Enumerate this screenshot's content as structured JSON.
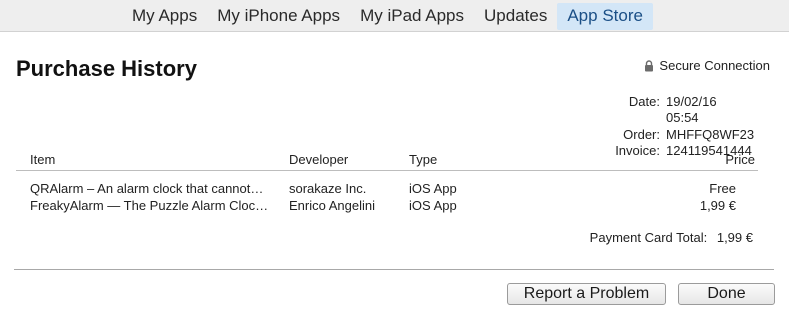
{
  "nav": {
    "tabs": [
      {
        "label": "My Apps"
      },
      {
        "label": "My iPhone Apps"
      },
      {
        "label": "My iPad Apps"
      },
      {
        "label": "Updates"
      },
      {
        "label": "App Store",
        "active": true
      }
    ]
  },
  "page": {
    "title": "Purchase History",
    "secure_label": "Secure Connection",
    "secure_icon": "lock-icon"
  },
  "meta": {
    "date_label": "Date:",
    "date_value": "19/02/16 05:54",
    "order_label": "Order:",
    "order_value": "MHFFQ8WF23",
    "invoice_label": "Invoice:",
    "invoice_value": "124119541444"
  },
  "table": {
    "headers": {
      "item": "Item",
      "developer": "Developer",
      "type": "Type",
      "price": "Price"
    },
    "rows": [
      {
        "item": "QRAlarm – An alarm clock that cannot…",
        "developer": "sorakaze Inc.",
        "type": "iOS App",
        "price": "Free"
      },
      {
        "item": "FreakyAlarm — The Puzzle Alarm Cloc…",
        "developer": "Enrico Angelini",
        "type": "iOS App",
        "price": "1,99 €"
      }
    ]
  },
  "total": {
    "label": "Payment Card Total:",
    "value": "1,99 €"
  },
  "buttons": {
    "report": "Report a Problem",
    "done": "Done"
  },
  "colors": {
    "active_tab_bg": "#d3e6f7",
    "active_tab_text": "#1b4f86",
    "topbar_bg": "#eeeeee"
  }
}
